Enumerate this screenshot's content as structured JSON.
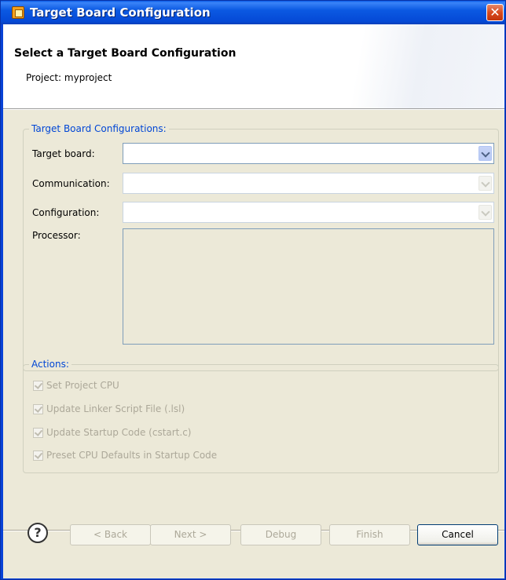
{
  "window": {
    "title": "Target Board Configuration",
    "close_symbol": "✕"
  },
  "header": {
    "title": "Select a Target Board Configuration",
    "subtitle": "Project: myproject"
  },
  "config_group": {
    "legend": "Target Board Configurations:",
    "target_board_label": "Target board:",
    "target_board_value": "",
    "communication_label": "Communication:",
    "communication_value": "",
    "configuration_label": "Configuration:",
    "configuration_value": "",
    "processor_label": "Processor:",
    "processor_value": ""
  },
  "actions_group": {
    "legend": "Actions:",
    "items": [
      {
        "label": "Set Project CPU",
        "checked": true,
        "enabled": false
      },
      {
        "label": "Update Linker Script File (.lsl)",
        "checked": true,
        "enabled": false
      },
      {
        "label": "Update Startup Code (cstart.c)",
        "checked": true,
        "enabled": false
      },
      {
        "label": "Preset CPU Defaults in Startup Code",
        "checked": true,
        "enabled": false
      }
    ]
  },
  "buttons": {
    "help_symbol": "?",
    "back": "< Back",
    "next": "Next >",
    "debug": "Debug",
    "finish": "Finish",
    "cancel": "Cancel"
  },
  "icons": {
    "app": "target-board-app-icon",
    "close": "close-icon",
    "help": "help-icon",
    "dropdown": "chevron-down-icon",
    "checkbox": "checkmark-icon"
  },
  "colors": {
    "title_bar": "#0549d6",
    "legend_text": "#0046d5",
    "dialog_background": "#ece9d8",
    "disabled_text": "#aca899"
  }
}
